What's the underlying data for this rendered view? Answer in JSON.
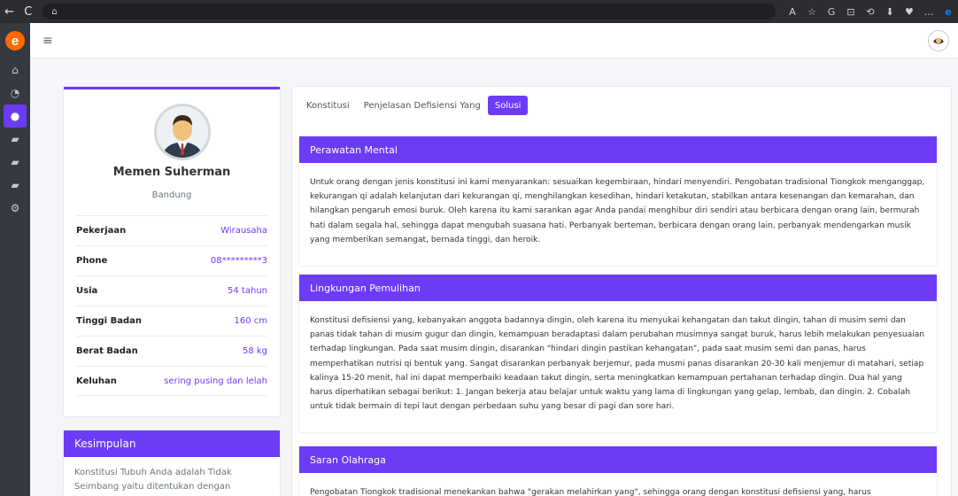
{
  "browser": {
    "back_icon": "←",
    "reload_icon": "C",
    "home_icon": "⌂",
    "right_icons": [
      "A",
      "☆",
      "G",
      "⊡",
      "⟲",
      "⬇",
      "♥",
      "…",
      "e"
    ]
  },
  "sidebar": {
    "logo_letter": "e",
    "items": [
      {
        "icon": "home-icon",
        "glyph": "⌂"
      },
      {
        "icon": "dashboard-icon",
        "glyph": "◔"
      },
      {
        "icon": "user-icon",
        "glyph": "●",
        "active": true
      },
      {
        "icon": "briefcase-icon",
        "glyph": "▰"
      },
      {
        "icon": "briefcase-icon",
        "glyph": "▰"
      },
      {
        "icon": "briefcase-icon",
        "glyph": "▰"
      },
      {
        "icon": "gears-icon",
        "glyph": "⚙"
      }
    ]
  },
  "topnav": {
    "menu_icon": "≡"
  },
  "profile": {
    "name": "Memen Suherman",
    "city": "Bandung",
    "rows": [
      {
        "label": "Pekerjaan",
        "value": "Wirausaha"
      },
      {
        "label": "Phone",
        "value": "08*********3"
      },
      {
        "label": "Usia",
        "value": "54 tahun"
      },
      {
        "label": "Tinggi Badan",
        "value": "160 cm"
      },
      {
        "label": "Berat Badan",
        "value": "58 kg"
      },
      {
        "label": "Keluhan",
        "value": "sering pusing dan lelah"
      }
    ]
  },
  "conclusion": {
    "title": "Kesimpulan",
    "text": "Konstitusi Tubuh Anda adalah Tidak Seimbang yaitu ditentukan dengan"
  },
  "tabs": [
    {
      "label": "Konstitusi",
      "active": false
    },
    {
      "label": "Penjelasan Defisiensi Yang",
      "active": false
    },
    {
      "label": "Solusi",
      "active": true
    }
  ],
  "sections": [
    {
      "title": "Perawatan Mental",
      "text": "Untuk orang dengan jenis konstitusi ini kami menyarankan: sesuaikan kegembiraan, hindari menyendiri. Pengobatan tradisional Tiongkok menganggap, kekurangan qi adalah kelanjutan dari kekurangan qi, menghilangkan kesedihan, hindari ketakutan, stabilkan antara kesenangan dan kemarahan, dan hilangkan pengaruh emosi buruk. Oleh karena itu kami sarankan agar Anda pandai menghibur diri sendiri atau berbicara dengan orang lain, bermurah hati dalam segala hal, sehingga dapat mengubah suasana hati. Perbanyak berteman, berbicara dengan orang lain, perbanyak mendengarkan musik yang memberikan semangat, bernada tinggi, dan heroik."
    },
    {
      "title": "Lingkungan Pemulihan",
      "text": "Konstitusi defisiensi yang, kebanyakan anggota badannya dingin, oleh karena itu menyukai kehangatan dan takut dingin, tahan di musim semi dan panas tidak tahan di musim gugur dan dingin, kemampuan beradaptasi dalam perubahan musimnya sangat buruk, harus lebih melakukan penyesuaian terhadap lingkungan. Pada saat musim dingin, disarankan \"hindari dingin pastikan kehangatan\", pada saat musim semi dan panas, harus memperhatikan nutrisi qi bentuk yang. Sangat disarankan perbanyak berjemur, pada musmi panas disarankan 20-30 kali menjemur di matahari, setiap kalinya 15-20 menit, hal ini dapat memperbaiki keadaan takut dingin, serta meningkatkan kemampuan pertahanan terhadap dingin. Dua hal yang harus diperhatikan sebagai berikut: 1. Jangan bekerja atau belajar untuk waktu yang lama di lingkungan yang gelap, lembab, dan dingin. 2. Cobalah untuk tidak bermain di tepi laut dengan perbedaan suhu yang besar di pagi dan sore hari."
    },
    {
      "title": "Saran Olahraga",
      "text": "Pengobatan Tiongkok tradisional menekankan bahwa \"gerakan melahirkan yang\", sehingga orang dengan konstitusi defisiensi yang, harus"
    }
  ],
  "colors": {
    "accent": "#6c3cf5",
    "sidebar": "#343a40",
    "logo": "#ff6a00"
  }
}
